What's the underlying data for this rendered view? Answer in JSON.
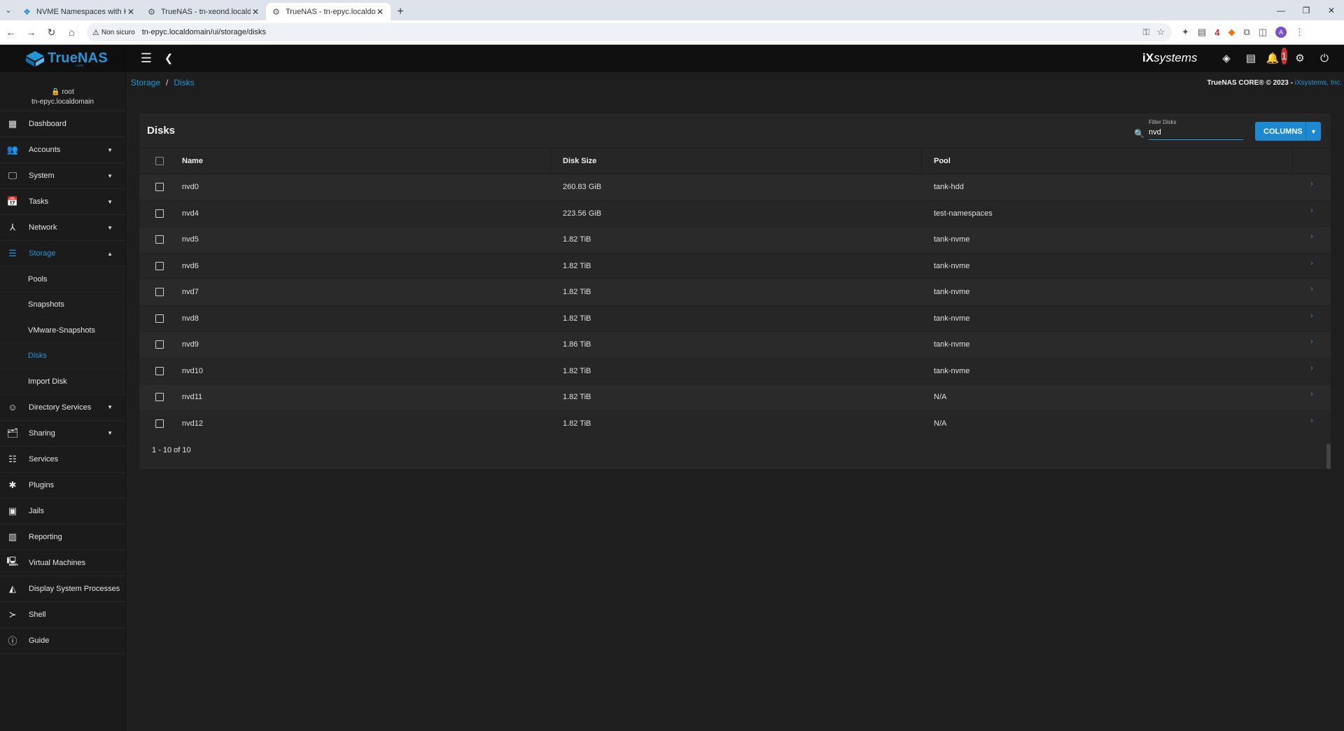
{
  "browser": {
    "tabs": [
      {
        "title": "NVME Namespaces with Kingst",
        "active": false
      },
      {
        "title": "TrueNAS - tn-xeond.localdomai",
        "active": false
      },
      {
        "title": "TrueNAS - tn-epyc.localdomain",
        "active": true
      }
    ],
    "security_label": "Non sicuro",
    "url": "tn-epyc.localdomain/ui/storage/disks",
    "extension_badge": "4",
    "profile_initial": "A"
  },
  "app": {
    "logo_text": "TrueNAS",
    "logo_sub": "CORE",
    "vendor_logo": "systems",
    "vendor_prefix": "iX",
    "notifications_count": "1"
  },
  "user": {
    "name": "root",
    "host": "tn-epyc.localdomain"
  },
  "sidebar": {
    "items": [
      {
        "label": "Dashboard",
        "icon": "dashboard-icon",
        "glyph": "▦",
        "caret": ""
      },
      {
        "label": "Accounts",
        "icon": "accounts-icon",
        "glyph": "👥",
        "caret": "▼"
      },
      {
        "label": "System",
        "icon": "system-icon",
        "glyph": "🖵",
        "caret": "▼"
      },
      {
        "label": "Tasks",
        "icon": "tasks-icon",
        "glyph": "📅",
        "caret": "▼"
      },
      {
        "label": "Network",
        "icon": "network-icon",
        "glyph": "⅄",
        "caret": "▼"
      },
      {
        "label": "Storage",
        "icon": "storage-icon",
        "glyph": "☰",
        "caret": "▲"
      }
    ],
    "storage_sub": [
      "Pools",
      "Snapshots",
      "VMware-Snapshots",
      "Disks",
      "Import Disk"
    ],
    "items_after": [
      {
        "label": "Directory Services",
        "icon": "directory-services-icon",
        "glyph": "☺",
        "caret": "▼"
      },
      {
        "label": "Sharing",
        "icon": "sharing-icon",
        "glyph": "🗂",
        "caret": "▼"
      },
      {
        "label": "Services",
        "icon": "services-icon",
        "glyph": "☷",
        "caret": ""
      },
      {
        "label": "Plugins",
        "icon": "plugins-icon",
        "glyph": "✱",
        "caret": ""
      },
      {
        "label": "Jails",
        "icon": "jails-icon",
        "glyph": "▣",
        "caret": ""
      },
      {
        "label": "Reporting",
        "icon": "reporting-icon",
        "glyph": "▥",
        "caret": ""
      },
      {
        "label": "Virtual Machines",
        "icon": "virtual-machines-icon",
        "glyph": "🖳",
        "caret": ""
      },
      {
        "label": "Display System Processes",
        "icon": "processes-icon",
        "glyph": "◭",
        "caret": ""
      },
      {
        "label": "Shell",
        "icon": "shell-icon",
        "glyph": "≻",
        "caret": ""
      },
      {
        "label": "Guide",
        "icon": "guide-icon",
        "glyph": "ⓘ",
        "caret": ""
      }
    ]
  },
  "breadcrumb": {
    "parent": "Storage",
    "separator": "/",
    "current": "Disks"
  },
  "copyright": {
    "text": "TrueNAS CORE® © 2023 - ",
    "link": "iXsystems, Inc."
  },
  "disks": {
    "title": "Disks",
    "filter_label": "Filter Disks",
    "filter_value": "nvd",
    "columns_label": "COLUMNS",
    "headers": {
      "name": "Name",
      "size": "Disk Size",
      "pool": "Pool"
    },
    "rows": [
      {
        "name": "nvd0",
        "size": "260.83 GiB",
        "pool": "tank-hdd"
      },
      {
        "name": "nvd4",
        "size": "223.56 GiB",
        "pool": "test-namespaces"
      },
      {
        "name": "nvd5",
        "size": "1.82 TiB",
        "pool": "tank-nvme"
      },
      {
        "name": "nvd6",
        "size": "1.82 TiB",
        "pool": "tank-nvme"
      },
      {
        "name": "nvd7",
        "size": "1.82 TiB",
        "pool": "tank-nvme"
      },
      {
        "name": "nvd8",
        "size": "1.82 TiB",
        "pool": "tank-nvme"
      },
      {
        "name": "nvd9",
        "size": "1.86 TiB",
        "pool": "tank-nvme"
      },
      {
        "name": "nvd10",
        "size": "1.82 TiB",
        "pool": "tank-nvme"
      },
      {
        "name": "nvd11",
        "size": "1.82 TiB",
        "pool": "N/A"
      },
      {
        "name": "nvd12",
        "size": "1.82 TiB",
        "pool": "N/A"
      }
    ],
    "pagination": "1 - 10 of 10"
  },
  "colors": {
    "accent": "#2496d6",
    "button": "#1e88d0",
    "background": "#1e1e1e",
    "card": "#262626"
  }
}
